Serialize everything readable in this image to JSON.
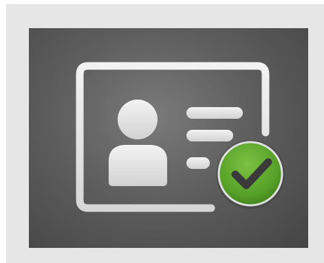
{
  "icon": {
    "name": "id-card-verified-icon",
    "parts": [
      "id-card-icon",
      "user-silhouette-icon",
      "text-lines-icon",
      "checkmark-badge-icon"
    ]
  },
  "colors": {
    "frame_background": "#e6e6e6",
    "tile_center": "#7a7a7a",
    "tile_edge": "#454545",
    "card_outline": "#e9e9e9",
    "check_green": "#5aa52a",
    "check_green_dark": "#3f7f1a",
    "check_mark": "#3a3a3a"
  }
}
